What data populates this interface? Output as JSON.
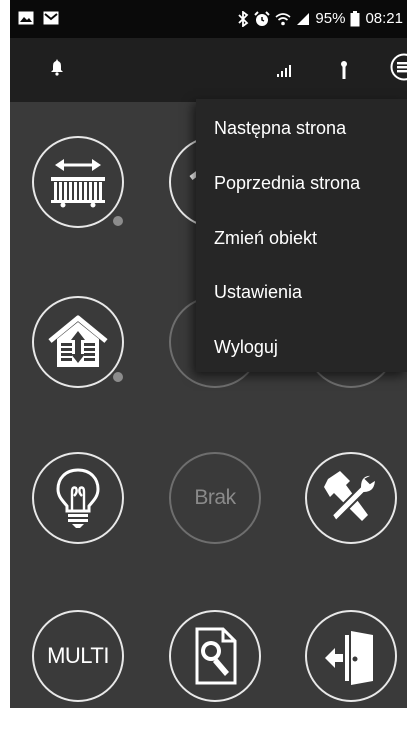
{
  "status_bar": {
    "left_icons": [
      "image-icon",
      "mail-icon"
    ],
    "right_icons": [
      "bluetooth-icon",
      "alarm-icon",
      "wifi-icon",
      "signal-icon",
      "battery-icon"
    ],
    "battery": "95%",
    "time": "08:21"
  },
  "app_bar": {
    "icons": [
      "bell-icon",
      "signal-bars-icon",
      "antenna-icon",
      "overflow-menu-icon"
    ]
  },
  "grid": {
    "tiles": [
      {
        "icon": "gate-icon"
      },
      {
        "icon": "garage-icon"
      },
      {
        "icon": "unknown-icon"
      },
      {
        "icon": "house-updown-icon"
      },
      {
        "icon": "clock-icon"
      },
      {
        "icon": "unknown-icon"
      },
      {
        "icon": "lightbulb-icon"
      },
      {
        "label": "Brak"
      },
      {
        "icon": "tools-icon"
      },
      {
        "label": "MULTI"
      },
      {
        "icon": "document-search-icon"
      },
      {
        "icon": "exit-door-icon"
      }
    ]
  },
  "menu": {
    "items": [
      {
        "label": "Następna strona"
      },
      {
        "label": "Poprzednia strona"
      },
      {
        "label": "Zmień obiekt"
      },
      {
        "label": "Ustawienia"
      },
      {
        "label": "Wyloguj"
      }
    ]
  },
  "colors": {
    "status_bar_bg": "#0a0a0a",
    "app_bar_bg": "#1f1f1f",
    "grid_bg": "#3a3a3a",
    "menu_bg": "#262626",
    "tile_border": "#e8e8e8",
    "dim_border": "#6e6e6e",
    "dot": "#8c8c8c"
  }
}
